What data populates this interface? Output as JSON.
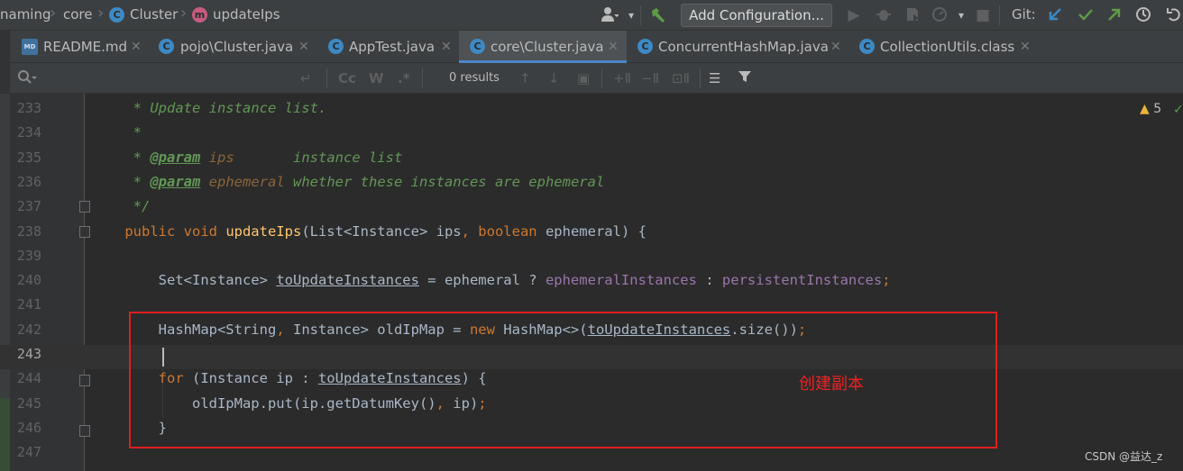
{
  "window": {
    "breadcrumbs": [
      {
        "label": "naming"
      },
      {
        "label": "core"
      },
      {
        "label": "Cluster",
        "icon": "class-icon"
      },
      {
        "label": "updateIps",
        "icon": "method-icon"
      }
    ],
    "add_config_label": "Add Configuration...",
    "git_label": "Git:"
  },
  "icons": {
    "class_letter": "C",
    "method_letter": "m",
    "markdown_letter": "MD"
  },
  "tabs": [
    {
      "label": "README.md",
      "icon": "markdown-icon",
      "active": false
    },
    {
      "label": "pojo\\Cluster.java",
      "icon": "class-icon",
      "active": false
    },
    {
      "label": "AppTest.java",
      "icon": "class-icon",
      "active": false
    },
    {
      "label": "core\\Cluster.java",
      "icon": "class-icon",
      "active": true
    },
    {
      "label": "ConcurrentHashMap.java",
      "icon": "class-icon",
      "active": false
    },
    {
      "label": "CollectionUtils.class",
      "icon": "class-icon",
      "active": false
    }
  ],
  "search": {
    "results_text": "0 results",
    "case_label": "Cc",
    "word_label": "W",
    "regex_label": ".*"
  },
  "editor": {
    "current_line": 243,
    "warnings_count": "5",
    "lines": [
      {
        "n": 233,
        "tokens": [
          {
            "t": "     * Update instance list.",
            "c": "cm"
          }
        ]
      },
      {
        "n": 234,
        "tokens": [
          {
            "t": "     *",
            "c": "cm"
          }
        ]
      },
      {
        "n": 235,
        "tokens": [
          {
            "t": "     * ",
            "c": "cm"
          },
          {
            "t": "@param",
            "c": "tag"
          },
          {
            "t": " ",
            "c": "cm"
          },
          {
            "t": "ips",
            "c": "prm"
          },
          {
            "t": "       instance list",
            "c": "cm"
          }
        ]
      },
      {
        "n": 236,
        "tokens": [
          {
            "t": "     * ",
            "c": "cm"
          },
          {
            "t": "@param",
            "c": "tag"
          },
          {
            "t": " ",
            "c": "cm"
          },
          {
            "t": "ephemeral",
            "c": "prm"
          },
          {
            "t": " whether these instances are ephemeral",
            "c": "cm"
          }
        ]
      },
      {
        "n": 237,
        "tokens": [
          {
            "t": "     */",
            "c": "cm"
          }
        ]
      },
      {
        "n": 238,
        "tokens": [
          {
            "t": "    ",
            "c": "d"
          },
          {
            "t": "public void ",
            "c": "kw"
          },
          {
            "t": "updateIps",
            "c": "fn"
          },
          {
            "t": "(List<Instance> ips",
            "c": "d"
          },
          {
            "t": ", ",
            "c": "kw"
          },
          {
            "t": "boolean ",
            "c": "kw"
          },
          {
            "t": "ephemeral) {",
            "c": "d"
          }
        ]
      },
      {
        "n": 239,
        "tokens": []
      },
      {
        "n": 240,
        "tokens": [
          {
            "t": "        Set<Instance> ",
            "c": "d"
          },
          {
            "t": "toUpdateInstances",
            "c": "ul"
          },
          {
            "t": " = ephemeral ? ",
            "c": "d"
          },
          {
            "t": "ephemeralInstances",
            "c": "fld"
          },
          {
            "t": " : ",
            "c": "d"
          },
          {
            "t": "persistentInstances",
            "c": "fld"
          },
          {
            "t": ";",
            "c": "kw"
          }
        ]
      },
      {
        "n": 241,
        "tokens": []
      },
      {
        "n": 242,
        "tokens": [
          {
            "t": "        HashMap<String",
            "c": "d"
          },
          {
            "t": ", ",
            "c": "kw"
          },
          {
            "t": "Instance> oldIpMap = ",
            "c": "d"
          },
          {
            "t": "new ",
            "c": "kw"
          },
          {
            "t": "HashMap<>(",
            "c": "d"
          },
          {
            "t": "toUpdateInstances",
            "c": "ul"
          },
          {
            "t": ".size())",
            "c": "d"
          },
          {
            "t": ";",
            "c": "kw"
          }
        ]
      },
      {
        "n": 243,
        "tokens": []
      },
      {
        "n": 244,
        "tokens": [
          {
            "t": "        ",
            "c": "d"
          },
          {
            "t": "for ",
            "c": "kw"
          },
          {
            "t": "(Instance ip : ",
            "c": "d"
          },
          {
            "t": "toUpdateInstances",
            "c": "ul"
          },
          {
            "t": ") {",
            "c": "d"
          }
        ]
      },
      {
        "n": 245,
        "tokens": [
          {
            "t": "            oldIpMap.put(ip.getDatumKey()",
            "c": "d"
          },
          {
            "t": ", ",
            "c": "kw"
          },
          {
            "t": "ip)",
            "c": "d"
          },
          {
            "t": ";",
            "c": "kw"
          }
        ]
      },
      {
        "n": 246,
        "tokens": [
          {
            "t": "        }",
            "c": "d"
          }
        ]
      },
      {
        "n": 247,
        "tokens": []
      }
    ]
  },
  "annotation": {
    "text": "创建副本",
    "color": "#e01e1e"
  },
  "watermark": "CSDN @益达_z",
  "colors": {
    "accent": "#4a88c7",
    "keyword": "#cc7832",
    "function": "#ffc66d",
    "field": "#9876aa",
    "comment": "#629755"
  }
}
